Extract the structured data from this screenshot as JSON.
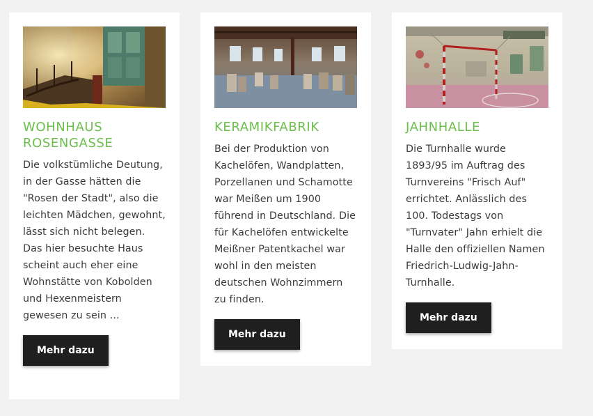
{
  "cards": [
    {
      "image_alt": "Verfallenes Treppenhaus",
      "title": "Wohnhaus Rosengasse",
      "text": "Die volkstümliche Deutung, in der Gasse hätten die \"Rosen der Stadt\", also die leichten Mädchen, gewohnt, lässt sich nicht belegen. Das hier besuchte Haus scheint auch eher eine Wohnstätte von Kobolden und Hexenmeistern gewesen zu sein ...",
      "button": "Mehr dazu"
    },
    {
      "image_alt": "Verlassene Fabrikhalle",
      "title": "Keramikfabrik",
      "text": "Bei der Produktion von Kachelöfen, Wandplatten, Porzellanen und Schamotte war Meißen um 1900 führend in Deutschland. Die für Kachelöfen entwickelte Meißner Patentkachel war wohl in den meisten deutschen Wohnzimmern zu finden.",
      "button": "Mehr dazu"
    },
    {
      "image_alt": "Verlassene Turnhalle",
      "title": "Jahnhalle",
      "text": "Die Turnhalle wurde 1893/95 im Auftrag des Turnvereins \"Frisch Auf\" errichtet. Anlässlich des 100. Todestags von \"Turnvater\" Jahn erhielt die Halle den offiziellen Namen Friedrich-Ludwig-Jahn-Turnhalle.",
      "button": "Mehr dazu"
    }
  ],
  "colors": {
    "page_background": "#f2f2f2",
    "card_background": "#ffffff",
    "title_green": "#6abf4b",
    "body_text": "#3a3a3a",
    "button_background": "#1f1f1f",
    "button_text": "#ffffff"
  }
}
